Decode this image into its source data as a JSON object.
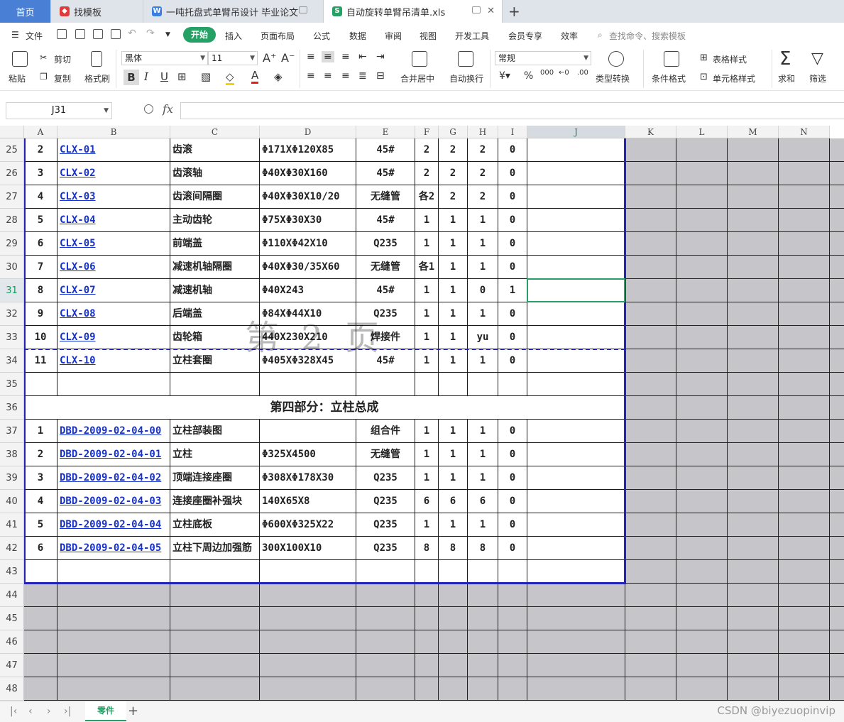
{
  "tabs": [
    {
      "label": "首页",
      "kind": "home"
    },
    {
      "label": "找模板",
      "kind": "template"
    },
    {
      "label": "一吨托盘式单臂吊设计 毕业论文",
      "kind": "word"
    },
    {
      "label": "自动旋转单臂吊清单.xls",
      "kind": "sheet"
    }
  ],
  "menu": {
    "file": "文件",
    "start": "开始",
    "items": [
      "插入",
      "页面布局",
      "公式",
      "数据",
      "审阅",
      "视图",
      "开发工具",
      "会员专享",
      "效率"
    ],
    "search": "查找命令、搜索模板"
  },
  "ribbon": {
    "paste": "粘贴",
    "cut": "剪切",
    "copy": "复制",
    "format_painter": "格式刷",
    "font_name": "黑体",
    "font_size": "11",
    "merge_center": "合并居中",
    "wrap": "自动换行",
    "number_format": "常规",
    "convert": "类型转换",
    "cond_format": "条件格式",
    "table_style": "表格样式",
    "cell_style": "单元格样式",
    "sum": "求和",
    "filter": "筛选"
  },
  "formula_bar": {
    "cell_ref": "J31",
    "fx": "fx",
    "value": ""
  },
  "columns": [
    "A",
    "B",
    "C",
    "D",
    "E",
    "F",
    "G",
    "H",
    "I",
    "J",
    "K",
    "L",
    "M",
    "N"
  ],
  "selected_column": "J",
  "selected_row": "31",
  "rows": [
    {
      "n": "25",
      "cells": [
        "2",
        "CLX-01",
        "齿滚",
        "Φ171XΦ120X85",
        "45#",
        "2",
        "2",
        "2",
        "0"
      ]
    },
    {
      "n": "26",
      "cells": [
        "3",
        "CLX-02",
        "齿滚轴",
        "Φ40XΦ30X160",
        "45#",
        "2",
        "2",
        "2",
        "0"
      ]
    },
    {
      "n": "27",
      "cells": [
        "4",
        "CLX-03",
        "齿滚间隔圈",
        "Φ40XΦ30X10/20",
        "无缝管",
        "各2",
        "2",
        "2",
        "0"
      ]
    },
    {
      "n": "28",
      "cells": [
        "5",
        "CLX-04",
        "主动齿轮",
        "Φ75XΦ30X30",
        "45#",
        "1",
        "1",
        "1",
        "0"
      ]
    },
    {
      "n": "29",
      "cells": [
        "6",
        "CLX-05",
        "前端盖",
        "Φ110XΦ42X10",
        "Q235",
        "1",
        "1",
        "1",
        "0"
      ]
    },
    {
      "n": "30",
      "cells": [
        "7",
        "CLX-06",
        "减速机轴隔圈",
        "Φ40XΦ30/35X60",
        "无缝管",
        "各1",
        "1",
        "1",
        "0"
      ]
    },
    {
      "n": "31",
      "cells": [
        "8",
        "CLX-07",
        "减速机轴",
        "Φ40X243",
        "45#",
        "1",
        "1",
        "0",
        "1"
      ]
    },
    {
      "n": "32",
      "cells": [
        "9",
        "CLX-08",
        "后端盖",
        "Φ84XΦ44X10",
        "Q235",
        "1",
        "1",
        "1",
        "0"
      ]
    },
    {
      "n": "33",
      "cells": [
        "10",
        "CLX-09",
        "齿轮箱",
        "440X230X210",
        "焊接件",
        "1",
        "1",
        "yu",
        "0"
      ]
    },
    {
      "n": "34",
      "cells": [
        "11",
        "CLX-10",
        "立柱套圈",
        "Φ405XΦ328X45",
        "45#",
        "1",
        "1",
        "1",
        "0"
      ]
    },
    {
      "n": "35",
      "cells": [
        "",
        "",
        "",
        "",
        "",
        "",
        "",
        "",
        ""
      ]
    },
    {
      "n": "36",
      "section": "第四部分：立柱总成"
    },
    {
      "n": "37",
      "cells": [
        "1",
        "DBD-2009-02-04-00",
        "立柱部装图",
        "",
        "组合件",
        "1",
        "1",
        "1",
        "0"
      ]
    },
    {
      "n": "38",
      "cells": [
        "2",
        "DBD-2009-02-04-01",
        "立柱",
        "Φ325X4500",
        "无缝管",
        "1",
        "1",
        "1",
        "0"
      ]
    },
    {
      "n": "39",
      "cells": [
        "3",
        "DBD-2009-02-04-02",
        "顶端连接座圈",
        "Φ308XΦ178X30",
        "Q235",
        "1",
        "1",
        "1",
        "0"
      ]
    },
    {
      "n": "40",
      "cells": [
        "4",
        "DBD-2009-02-04-03",
        "连接座圈补强块",
        "140X65X8",
        "Q235",
        "6",
        "6",
        "6",
        "0"
      ]
    },
    {
      "n": "41",
      "cells": [
        "5",
        "DBD-2009-02-04-04",
        "立柱底板",
        "Φ600XΦ325X22",
        "Q235",
        "1",
        "1",
        "1",
        "0"
      ]
    },
    {
      "n": "42",
      "cells": [
        "6",
        "DBD-2009-02-04-05",
        "立柱下周边加强筋",
        "300X100X10",
        "Q235",
        "8",
        "8",
        "8",
        "0"
      ]
    },
    {
      "n": "43",
      "cells": [
        "",
        "",
        "",
        "",
        "",
        "",
        "",
        "",
        ""
      ]
    },
    {
      "n": "44"
    },
    {
      "n": "45"
    },
    {
      "n": "46"
    },
    {
      "n": "47"
    },
    {
      "n": "48"
    }
  ],
  "watermark": "第 2 页",
  "sheet_tab": "零件",
  "credit": "CSDN @biyezuopinvip"
}
